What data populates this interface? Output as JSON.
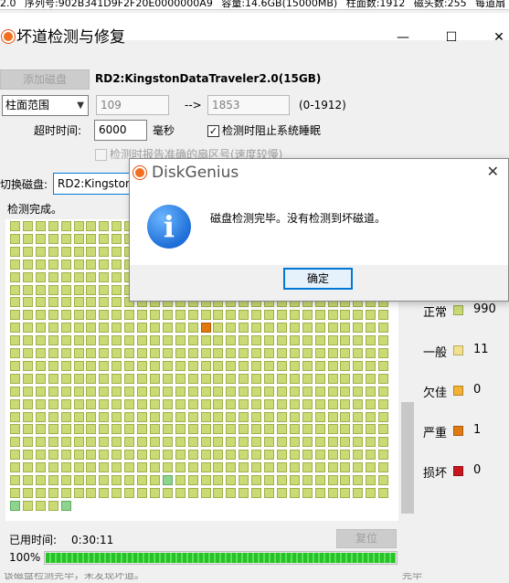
{
  "info_bar": {
    "items": [
      "2.0",
      "序列号:902B341D9F2F20E0000000A9",
      "容量:14.6GB(15000MB)",
      "柱面数:1912",
      "磁头数:255",
      "每道扇"
    ]
  },
  "window": {
    "title": "坏道检测与修复",
    "minimize": "—",
    "maximize": "☐",
    "close": "✕"
  },
  "toolbar": {
    "add_disk": "添加磁盘",
    "disk_name": "RD2:KingstonDataTraveler2.0(15GB)"
  },
  "range": {
    "mode": "柱面范围",
    "start_placeholder": "109",
    "end_placeholder": "1853",
    "arrow": "-->",
    "total": "(0-1912)"
  },
  "timeout": {
    "label": "超时时间:",
    "value": "6000",
    "unit": "毫秒"
  },
  "prevent_sleep": {
    "label": "检测时阻止系统睡眠",
    "checked": "✓"
  },
  "report_sector": {
    "label": "检测时报告准确的扇区号(速度较慢)"
  },
  "switch_disk": {
    "label": "切换磁盘:",
    "value": "RD2:Kingston"
  },
  "status_text": "检测完成。",
  "legend": [
    {
      "label": "正常",
      "count": "990",
      "color": "#cbda74"
    },
    {
      "label": "一般",
      "count": "11",
      "color": "#f2e08a"
    },
    {
      "label": "欠佳",
      "count": "0",
      "color": "#f2b133"
    },
    {
      "label": "严重",
      "count": "1",
      "color": "#e07a10"
    },
    {
      "label": "损坏",
      "count": "0",
      "color": "#c8151e"
    }
  ],
  "elapsed": {
    "label": "已用时间:",
    "value": "0:30:11"
  },
  "reset_button": "复位",
  "progress": {
    "percent": "100%",
    "fraction": 1
  },
  "dialog": {
    "title": "DiskGenius",
    "message": "磁盘检测完毕。没有检测到坏磁道。",
    "ok": "确定",
    "close": "✕",
    "icon_glyph": "i"
  },
  "bottom_hint": "该磁盘检测完毕，未发现坏道。",
  "bottom_right": "完毕"
}
